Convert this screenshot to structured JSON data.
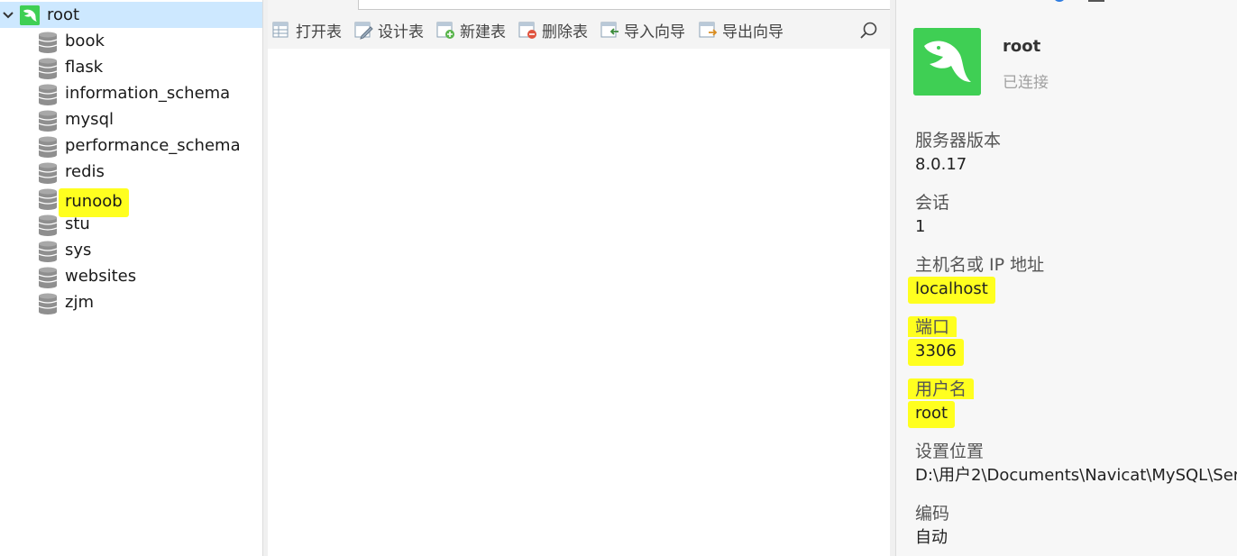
{
  "tree": {
    "connection": "root",
    "databases": [
      "book",
      "flask",
      "information_schema",
      "mysql",
      "performance_schema",
      "redis",
      "runoob",
      "stu",
      "sys",
      "websites",
      "zjm"
    ],
    "highlighted": "runoob"
  },
  "toolbar": {
    "open_table": "打开表",
    "design_table": "设计表",
    "new_table": "新建表",
    "delete_table": "删除表",
    "import_wizard": "导入向导",
    "export_wizard": "导出向导"
  },
  "info": {
    "name": "root",
    "status": "已连接",
    "server_version_label": "服务器版本",
    "server_version": "8.0.17",
    "session_label": "会话",
    "session": "1",
    "host_label": "主机名或 IP 地址",
    "host": "localhost",
    "port_label": "端口",
    "port": "3306",
    "user_label": "用户名",
    "user": "root",
    "location_label": "设置位置",
    "location": "D:\\用户2\\Documents\\Navicat\\MySQL\\Ser",
    "encoding_label": "编码",
    "encoding": "自动"
  },
  "colors": {
    "selection": "#cde8ff",
    "highlight": "#ffff1f",
    "brand_green": "#3fcf54"
  }
}
